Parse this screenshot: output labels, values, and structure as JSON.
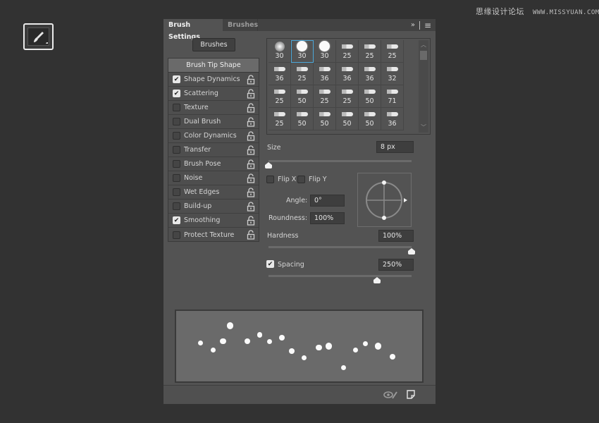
{
  "watermark": {
    "cn": "思缘设计论坛",
    "url": "WWW.MISSYUAN.COM"
  },
  "tool_button": {
    "icon": "brush-icon"
  },
  "panel": {
    "tabs": [
      {
        "label": "Brush Settings",
        "active": true
      },
      {
        "label": "Brushes",
        "active": false
      }
    ],
    "tab_icons": {
      "expand": "»",
      "menu": "≡"
    },
    "brushes_button": "Brushes",
    "options_header": "Brush Tip Shape",
    "options": [
      {
        "label": "Shape Dynamics",
        "checked": true
      },
      {
        "label": "Scattering",
        "checked": true
      },
      {
        "label": "Texture",
        "checked": false
      },
      {
        "label": "Dual Brush",
        "checked": false
      },
      {
        "label": "Color Dynamics",
        "checked": false
      },
      {
        "label": "Transfer",
        "checked": false
      },
      {
        "label": "Brush Pose",
        "checked": false
      },
      {
        "label": "Noise",
        "checked": false
      },
      {
        "label": "Wet Edges",
        "checked": false
      },
      {
        "label": "Build-up",
        "checked": false
      },
      {
        "label": "Smoothing",
        "checked": true
      },
      {
        "label": "Protect Texture",
        "checked": false
      }
    ],
    "brush_presets": [
      {
        "size": "30",
        "type": "soft"
      },
      {
        "size": "30",
        "type": "hard",
        "selected": true
      },
      {
        "size": "30",
        "type": "hard"
      },
      {
        "size": "25",
        "type": "tip"
      },
      {
        "size": "25",
        "type": "tip"
      },
      {
        "size": "25",
        "type": "tip"
      },
      {
        "size": "36",
        "type": "tip"
      },
      {
        "size": "25",
        "type": "tip"
      },
      {
        "size": "36",
        "type": "tip"
      },
      {
        "size": "36",
        "type": "tip"
      },
      {
        "size": "36",
        "type": "tip"
      },
      {
        "size": "32",
        "type": "tip"
      },
      {
        "size": "25",
        "type": "tip"
      },
      {
        "size": "50",
        "type": "tip"
      },
      {
        "size": "25",
        "type": "tip"
      },
      {
        "size": "25",
        "type": "tip"
      },
      {
        "size": "50",
        "type": "tip"
      },
      {
        "size": "71",
        "type": "tip"
      },
      {
        "size": "25",
        "type": "tip"
      },
      {
        "size": "50",
        "type": "tip"
      },
      {
        "size": "50",
        "type": "tip"
      },
      {
        "size": "50",
        "type": "tip"
      },
      {
        "size": "50",
        "type": "tip"
      },
      {
        "size": "36",
        "type": "tip"
      }
    ],
    "size": {
      "label": "Size",
      "value": "8 px",
      "slider_fraction": 0.0
    },
    "flip_x": {
      "label": "Flip X",
      "checked": false
    },
    "flip_y": {
      "label": "Flip Y",
      "checked": false
    },
    "angle": {
      "label": "Angle:",
      "value": "0°"
    },
    "roundness": {
      "label": "Roundness:",
      "value": "100%"
    },
    "hardness": {
      "label": "Hardness",
      "value": "100%",
      "slider_fraction": 1.0
    },
    "spacing": {
      "label": "Spacing",
      "value": "250%",
      "checked": true,
      "slider_fraction": 0.76
    },
    "preview_dots": [
      [
        0.1,
        0.45,
        1
      ],
      [
        0.15,
        0.55,
        1
      ],
      [
        0.19,
        0.43,
        1.2
      ],
      [
        0.22,
        0.21,
        1.3
      ],
      [
        0.29,
        0.43,
        1.2
      ],
      [
        0.34,
        0.34,
        1.1
      ],
      [
        0.38,
        0.43,
        1
      ],
      [
        0.43,
        0.38,
        1.1
      ],
      [
        0.47,
        0.57,
        1.1
      ],
      [
        0.52,
        0.66,
        1
      ],
      [
        0.58,
        0.52,
        1.2
      ],
      [
        0.62,
        0.5,
        1.3
      ],
      [
        0.68,
        0.8,
        1
      ],
      [
        0.73,
        0.55,
        1
      ],
      [
        0.77,
        0.46,
        1
      ],
      [
        0.82,
        0.5,
        1.3
      ],
      [
        0.88,
        0.65,
        1.2
      ]
    ],
    "footer_icons": [
      "eye-brush-icon",
      "new-brush-icon"
    ]
  }
}
